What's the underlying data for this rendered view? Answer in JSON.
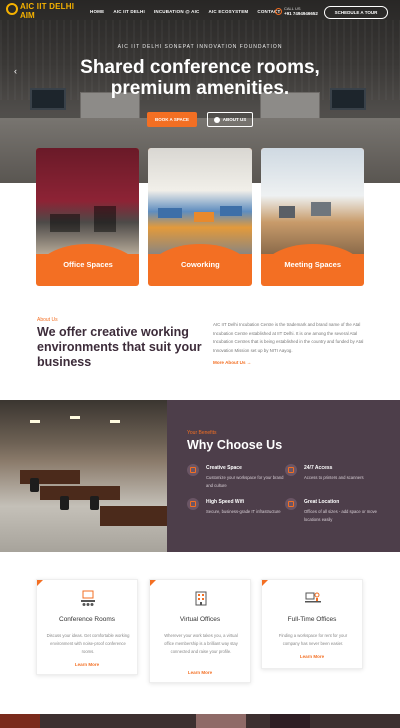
{
  "brand": {
    "logo_text": "AIC IIT DELHI",
    "partner_text": "AIM"
  },
  "nav": {
    "links": [
      "HOME",
      "AIC IIT DELHI",
      "INCUBATION @ AIC",
      "AIC ECOSYSTEM",
      "CONTACT"
    ],
    "call_label": "CALL US",
    "call_number": "+91 7494946652",
    "tour_button": "SCHEDULE A TOUR"
  },
  "hero": {
    "eyebrow": "AIC IIT DELHI SONEPAT INNOVATION FOUNDATION",
    "headline_line1": "Shared conference rooms,",
    "headline_line2": "premium amenities.",
    "book_button": "BOOK A SPACE",
    "about_button": "ABOUT US"
  },
  "spaces": [
    {
      "label": "Office Spaces"
    },
    {
      "label": "Coworking"
    },
    {
      "label": "Meeting Spaces"
    }
  ],
  "about": {
    "eyebrow": "About Us",
    "title": "We offer creative working environments that suit your business",
    "text": "AIC IIT Delhi Incubation Centre is the trademark and brand name of the Atal Incubation Centre established at IIT Delhi. It is one among the several Atal Incubation Centres that is being established in the country and funded by Atal Innovation Mission set up by NITI Aayog.",
    "more_link": "More About Us →"
  },
  "why": {
    "eyebrow": "Your Benefits",
    "title": "Why Choose Us",
    "features": [
      {
        "icon": "creative-space-icon",
        "title": "Creative Space",
        "desc": "Customize your workspace for your brand and culture"
      },
      {
        "icon": "clock-24-icon",
        "title": "24/7 Access",
        "desc": "Access to printers and scanners"
      },
      {
        "icon": "wifi-icon",
        "title": "High Speed Wifi",
        "desc": "Secure, business-grade IT infrastructure"
      },
      {
        "icon": "location-pin-icon",
        "title": "Great Location",
        "desc": "Offices of all sizes - add space or move locations easily"
      }
    ]
  },
  "offerings": [
    {
      "icon": "conference-icon",
      "title": "Conference Rooms",
      "desc": "Discuss your ideas. Get comfortable working environment with noise-proof conference rooms.",
      "more": "Learn More"
    },
    {
      "icon": "building-icon",
      "title": "Virtual Offices",
      "desc": "Wherever your work takes you, a virtual office membership is a brilliant way stay connected and raise your profile.",
      "more": "Learn More"
    },
    {
      "icon": "desk-icon",
      "title": "Full-Time Offices",
      "desc": "Finding a workspace for rent for your company has never been easier.",
      "more": "Learn More"
    }
  ],
  "colors": {
    "accent": "#f36f23",
    "dark_panel": "#4d3e4a",
    "heading": "#3d2c3a"
  }
}
